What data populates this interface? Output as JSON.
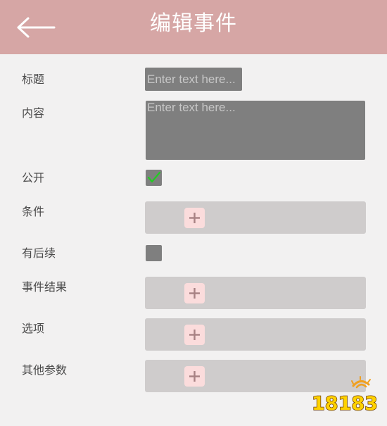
{
  "header": {
    "title": "编辑事件",
    "back_icon": "arrow-left-icon"
  },
  "form": {
    "title_label": "标题",
    "title_placeholder": "Enter text here...",
    "title_value": "",
    "content_label": "内容",
    "content_placeholder": "Enter text here...",
    "content_value": "",
    "public_label": "公开",
    "public_checked": true,
    "conditions_label": "条件",
    "has_followup_label": "有后续",
    "has_followup_checked": false,
    "results_label": "事件结果",
    "options_label": "选项",
    "params_label": "其他参数",
    "add_icon": "plus-icon"
  },
  "colors": {
    "header_bg": "#d6a6a5",
    "page_bg": "#f2f1f1",
    "input_bg": "#7f7f7f",
    "panel_bg": "#cfcccc",
    "add_button_bg": "#fbdcdc",
    "add_icon_color": "#a88284",
    "check_color": "#22cc22"
  },
  "watermark": {
    "text": "18183"
  }
}
